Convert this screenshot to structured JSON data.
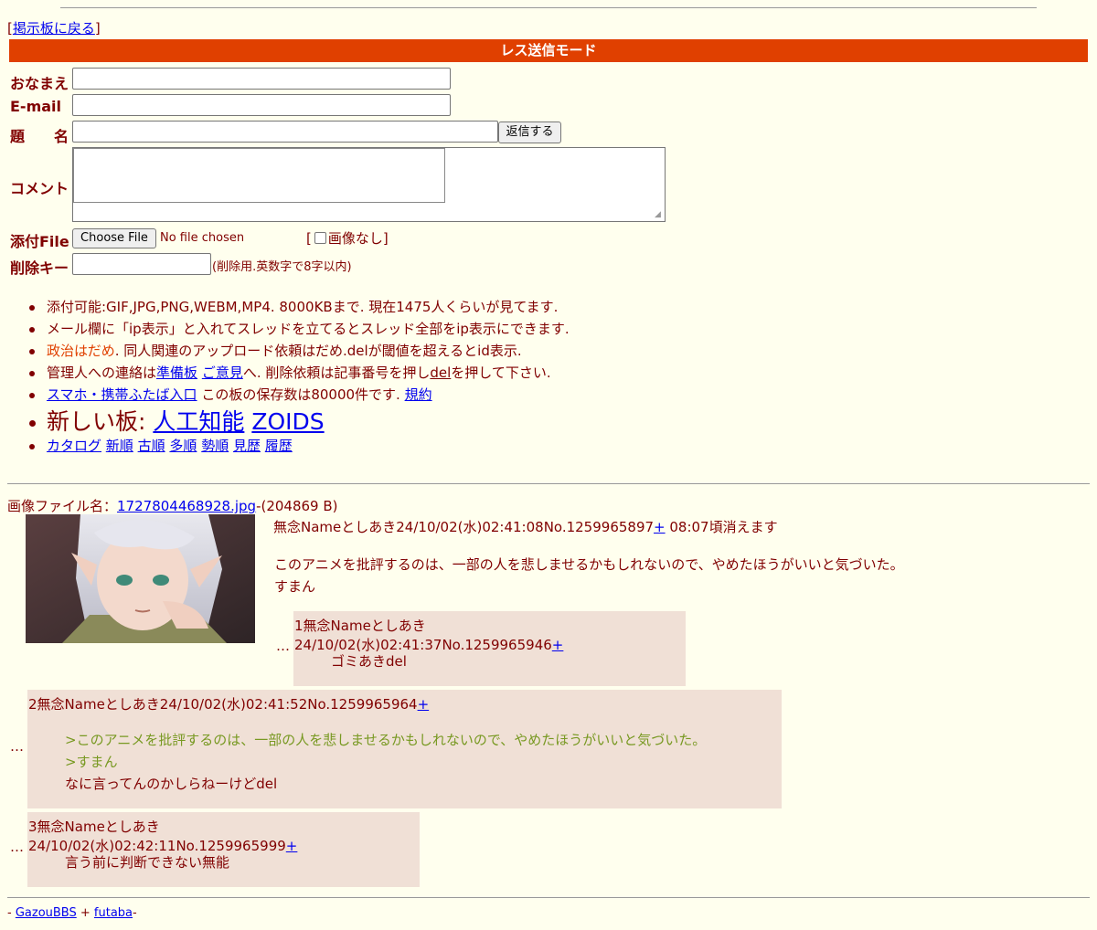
{
  "nav": {
    "back_prefix": "[",
    "back_link": "掲示板に戻る",
    "back_suffix": "]"
  },
  "mode_title": "レス送信モード",
  "form": {
    "name_label": "おなまえ",
    "email_label": "E-mail",
    "subject_label": "題　　名",
    "submit_label": "返信する",
    "comment_label": "コメント",
    "file_label": "添付File",
    "file_button": "Choose File",
    "file_status": "No file chosen",
    "noimage_prefix": "[",
    "noimage_label": "画像なし",
    "noimage_suffix": "]",
    "delkey_label": "削除キー",
    "delkey_note": "(削除用.英数字で8字以内)"
  },
  "rules": {
    "line1": "添付可能:GIF,JPG,PNG,WEBM,MP4. 8000KBまで. 現在1475人くらいが見てます.",
    "line2": "メール欄に「ip表示」と入れてスレッドを立てるとスレッド全部をip表示にできます.",
    "line3_red": "政治はだめ",
    "line3_rest": ". 同人関連のアップロード依頼はだめ.delが閾値を超えるとid表示.",
    "line4_pre": "管理人への連絡は",
    "line4_link1": "準備板",
    "line4_link2": "ご意見",
    "line4_mid": "へ. 削除依頼は記事番号を押し",
    "line4_link3": "del",
    "line4_post": "を押して下さい.",
    "line5_link1": "スマホ・携帯ふたば入口",
    "line5_mid": " この板の保存数は80000件です. ",
    "line5_link2": "規約",
    "new_boards_label": "新しい板: ",
    "new_board1": "人工知能",
    "new_board2": "ZOIDS",
    "sort_links": [
      "カタログ",
      "新順",
      "古順",
      "多順",
      "勢順",
      "見歴",
      "履歴"
    ]
  },
  "thread": {
    "file_prefix": "画像ファイル名：",
    "file_name": "1727804468928.jpg",
    "file_size": "-(204869 B)",
    "op_header": "無念Nameとしあき24/10/02(水)02:41:08No.1259965897",
    "op_plus": "+",
    "op_expire": " 08:07頃消えます",
    "op_body1": "このアニメを批評するのは、一部の人を悲しませるかもしれないので、やめたほうがいいと気づいた。",
    "op_body2": "すまん",
    "replies": [
      {
        "header": "1無念Nameとしあき24/10/02(水)02:41:37No.1259965946",
        "plus": "+",
        "body": "ゴミあきdel"
      },
      {
        "header": "2無念Nameとしあき24/10/02(水)02:41:52No.1259965964",
        "plus": "+",
        "quote1": ">このアニメを批評するのは、一部の人を悲しませるかもしれないので、やめたほうがいいと気づいた。",
        "quote2": ">すまん",
        "body": "なに言ってんのかしらねーけどdel"
      },
      {
        "header": "3無念Nameとしあき24/10/02(水)02:42:11No.1259965999",
        "plus": "+",
        "body": "言う前に判断できない無能"
      }
    ],
    "ellipsis": "…"
  },
  "footer": {
    "prefix": "- ",
    "link1": "GazouBBS",
    "sep": " + ",
    "link2": "futaba",
    "suffix": "-"
  }
}
